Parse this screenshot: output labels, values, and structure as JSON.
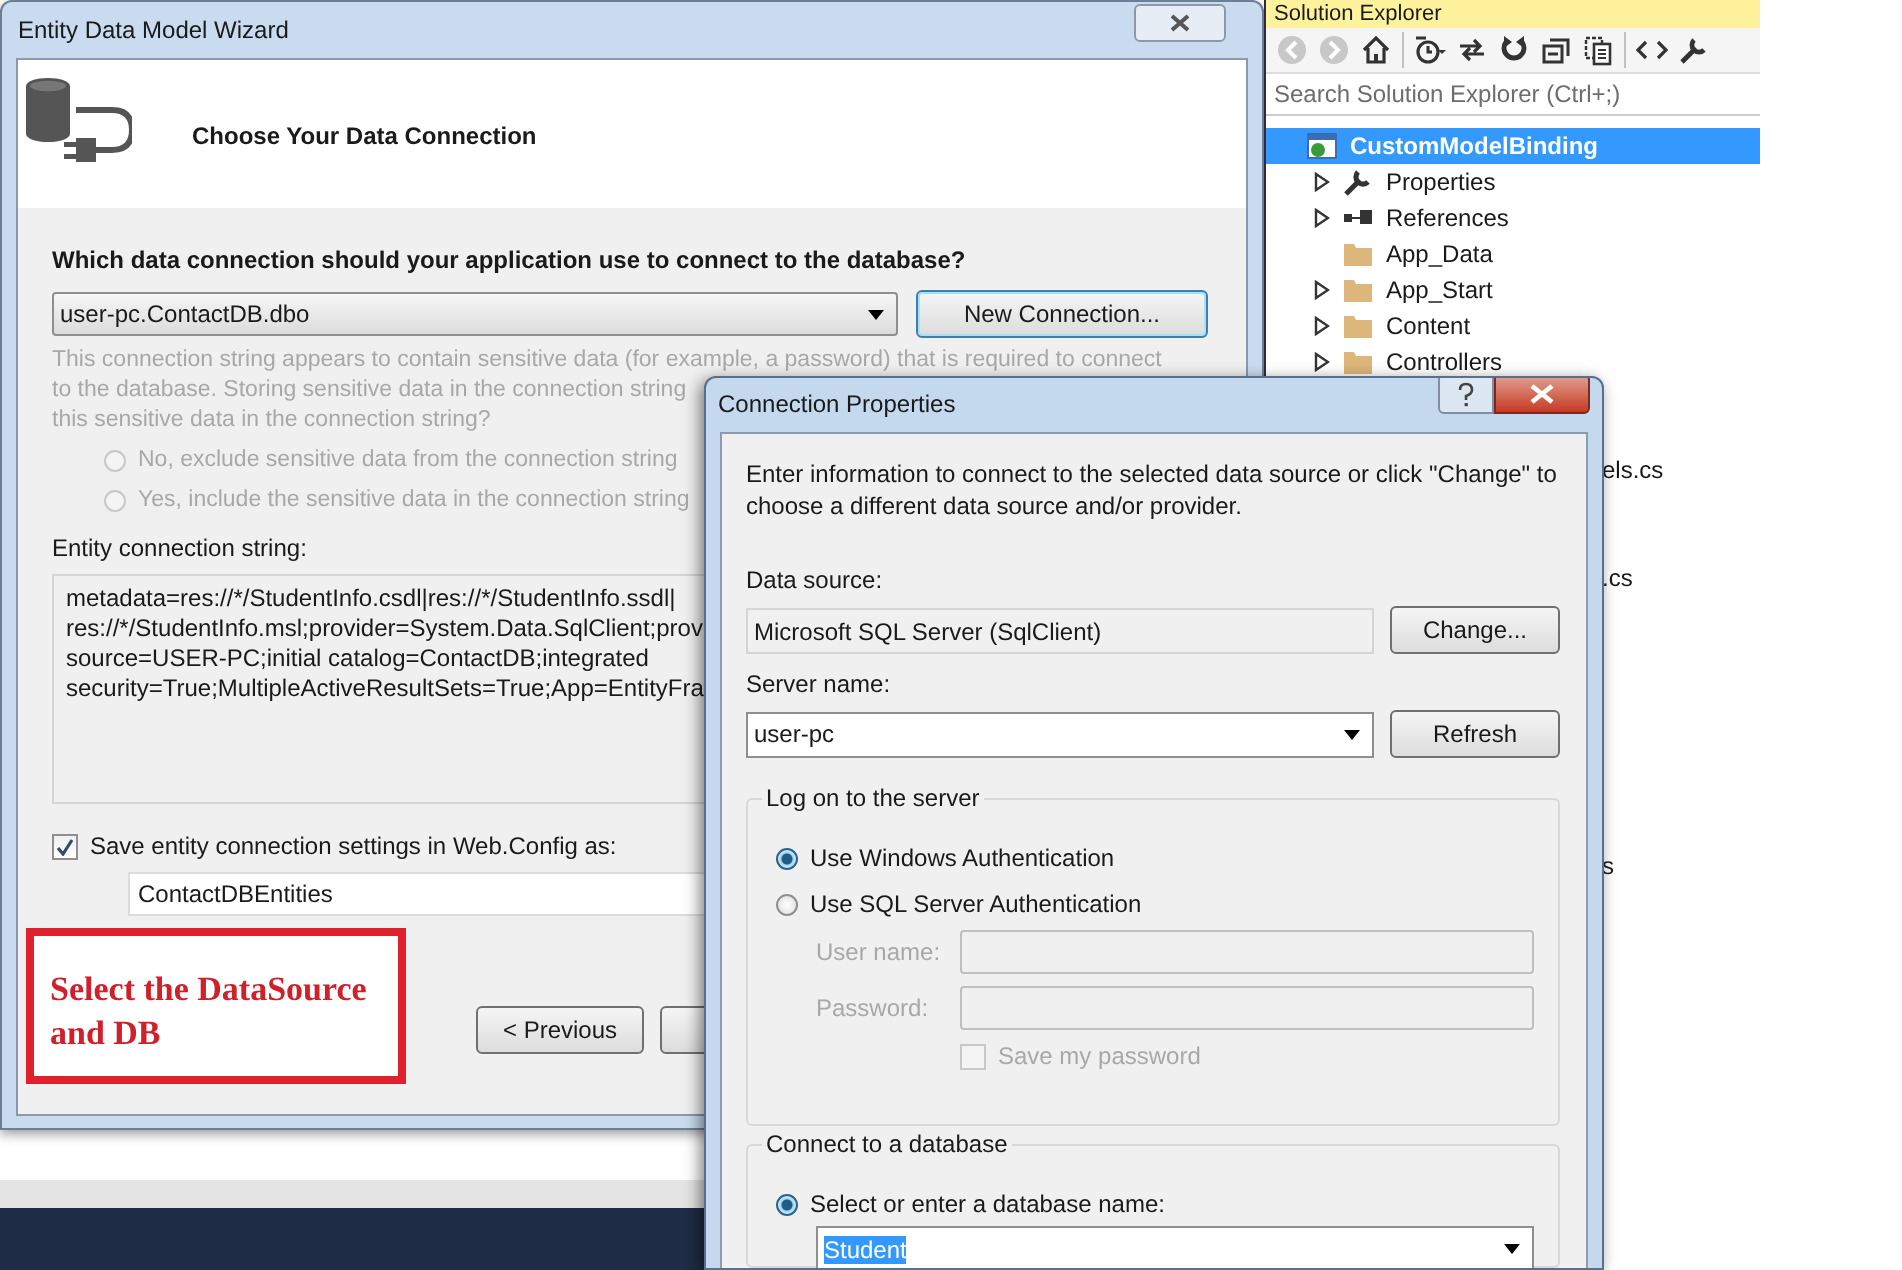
{
  "wizard": {
    "title": "Entity Data Model Wizard",
    "header": "Choose Your Data Connection",
    "question": "Which data connection should your application use to connect to the database?",
    "connection": {
      "value": "user-pc.ContactDB.dbo"
    },
    "new_connection_button": "New Connection...",
    "notice_lines": [
      "This connection string appears to contain sensitive data (for example, a password) that is required to connect",
      "to the database. Storing sensitive data in the connection string",
      "this sensitive data in the connection string?"
    ],
    "sensitive_options": [
      {
        "label": "No, exclude sensitive data from the connection string",
        "selected": false,
        "disabled": true
      },
      {
        "label": "Yes, include the sensitive data in the connection string",
        "selected": false,
        "disabled": true
      }
    ],
    "connection_string_label": "Entity connection string:",
    "connection_string_lines": [
      "metadata=res://*/StudentInfo.csdl|res://*/StudentInfo.ssdl|",
      "res://*/StudentInfo.msl;provider=System.Data.SqlClient;prov",
      "source=USER-PC;initial catalog=ContactDB;integrated",
      "security=True;MultipleActiveResultSets=True;App=EntityFra"
    ],
    "save_setting": {
      "label": "Save entity connection settings in Web.Config as:",
      "checked": true
    },
    "entities_name": "ContactDBEntities",
    "buttons": [
      "< Previous"
    ],
    "annotation": "Select the DataSource and DB"
  },
  "solution_explorer": {
    "title": "Solution Explorer",
    "search": {
      "placeholder": "Search Solution Explorer (Ctrl+;)"
    },
    "tree": [
      {
        "label": "CustomModelBinding",
        "kind": "project",
        "selected": true,
        "children": [
          {
            "label": "Properties",
            "kind": "properties",
            "selected": false,
            "expanded": false,
            "collapsible": true
          },
          {
            "label": "References",
            "kind": "references",
            "selected": false,
            "expanded": false,
            "collapsible": true
          },
          {
            "label": "App_Data",
            "kind": "folder",
            "selected": false,
            "collapsible": false
          },
          {
            "label": "App_Start",
            "kind": "folder",
            "selected": false,
            "expanded": false,
            "collapsible": true
          },
          {
            "label": "Content",
            "kind": "folder",
            "selected": false,
            "expanded": false,
            "collapsible": true
          },
          {
            "label": "Controllers",
            "kind": "folder",
            "selected": false,
            "expanded": false,
            "collapsible": true
          }
        ]
      }
    ],
    "fragments": [
      "els.cs",
      ".cs",
      "s"
    ]
  },
  "dialog": {
    "title": "Connection Properties",
    "description": "Enter information to connect to the selected data source or click \"Change\" to choose a different data source and/or provider.",
    "data_source": {
      "label": "Data source:",
      "value": "Microsoft SQL Server (SqlClient)",
      "button": "Change..."
    },
    "server_name": {
      "label": "Server name:",
      "value": "user-pc",
      "button": "Refresh"
    },
    "logon": {
      "title": "Log on to the server",
      "options": [
        {
          "label": "Use Windows Authentication",
          "selected": true
        },
        {
          "label": "Use SQL Server Authentication",
          "selected": false
        }
      ],
      "user_name": {
        "label": "User name:",
        "disabled": true
      },
      "password": {
        "label": "Password:",
        "disabled": true
      },
      "save_password": {
        "label": "Save my password",
        "checked": false,
        "disabled": true
      }
    },
    "database": {
      "title": "Connect to a database",
      "option": {
        "label": "Select or enter a database name:",
        "selected": true
      },
      "value": "Student",
      "highlighted": true
    }
  }
}
